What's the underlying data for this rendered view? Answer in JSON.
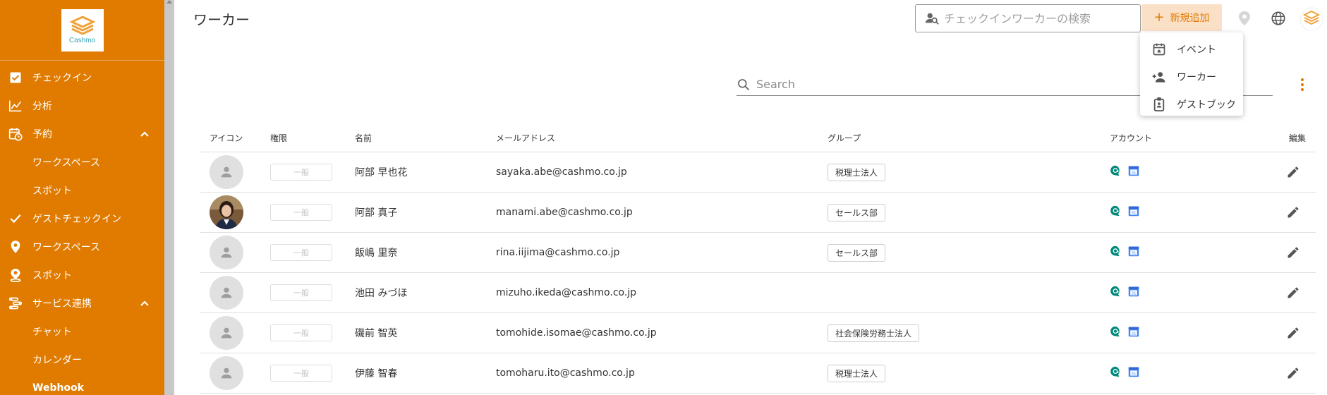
{
  "app": {
    "logo_text": "Cashmo",
    "brand_color": "#e07b00"
  },
  "sidebar": {
    "items": [
      {
        "label": "チェックイン",
        "icon": "checkbox-icon"
      },
      {
        "label": "分析",
        "icon": "chart-line-icon"
      },
      {
        "label": "予約",
        "icon": "calendar-clock-icon",
        "expanded": true
      },
      {
        "label": "ワークスペース",
        "sub": true
      },
      {
        "label": "スポット",
        "sub": true
      },
      {
        "label": "ゲストチェックイン",
        "icon": "check-icon"
      },
      {
        "label": "ワークスペース",
        "icon": "location-pin-icon"
      },
      {
        "label": "スポット",
        "icon": "person-pin-icon"
      },
      {
        "label": "サービス連携",
        "icon": "integration-icon",
        "expanded": true
      },
      {
        "label": "チャット",
        "sub": true
      },
      {
        "label": "カレンダー",
        "sub": true
      },
      {
        "label": "Webhook",
        "sub": true
      }
    ]
  },
  "header": {
    "title": "ワーカー",
    "checkin_search_placeholder": "チェックインワーカーの検索",
    "add_label": "新規追加"
  },
  "dropdown": {
    "items": [
      {
        "label": "イベント",
        "icon": "event-star-icon"
      },
      {
        "label": "ワーカー",
        "icon": "person-add-icon"
      },
      {
        "label": "ゲストブック",
        "icon": "badge-icon"
      }
    ]
  },
  "table": {
    "search_placeholder": "Search",
    "columns": {
      "icon": "アイコン",
      "role": "権限",
      "name": "名前",
      "email": "メールアドレス",
      "group": "グループ",
      "account": "アカウント",
      "edit": "編集"
    },
    "rows": [
      {
        "role": "一般",
        "name": "阿部 早也花",
        "email": "sayaka.abe@cashmo.co.jp",
        "group": "税理士法人",
        "photo": false
      },
      {
        "role": "一般",
        "name": "阿部 真子",
        "email": "manami.abe@cashmo.co.jp",
        "group": "セールス部",
        "photo": true
      },
      {
        "role": "一般",
        "name": "飯嶋 里奈",
        "email": "rina.iijima@cashmo.co.jp",
        "group": "セールス部",
        "photo": false
      },
      {
        "role": "一般",
        "name": "池田 みづほ",
        "email": "mizuho.ikeda@cashmo.co.jp",
        "group": "",
        "photo": false
      },
      {
        "role": "一般",
        "name": "磯前 智英",
        "email": "tomohide.isomae@cashmo.co.jp",
        "group": "社会保険労務士法人",
        "photo": false
      },
      {
        "role": "一般",
        "name": "伊藤 智春",
        "email": "tomoharu.ito@cashmo.co.jp",
        "group": "税理士法人",
        "photo": false
      }
    ]
  }
}
